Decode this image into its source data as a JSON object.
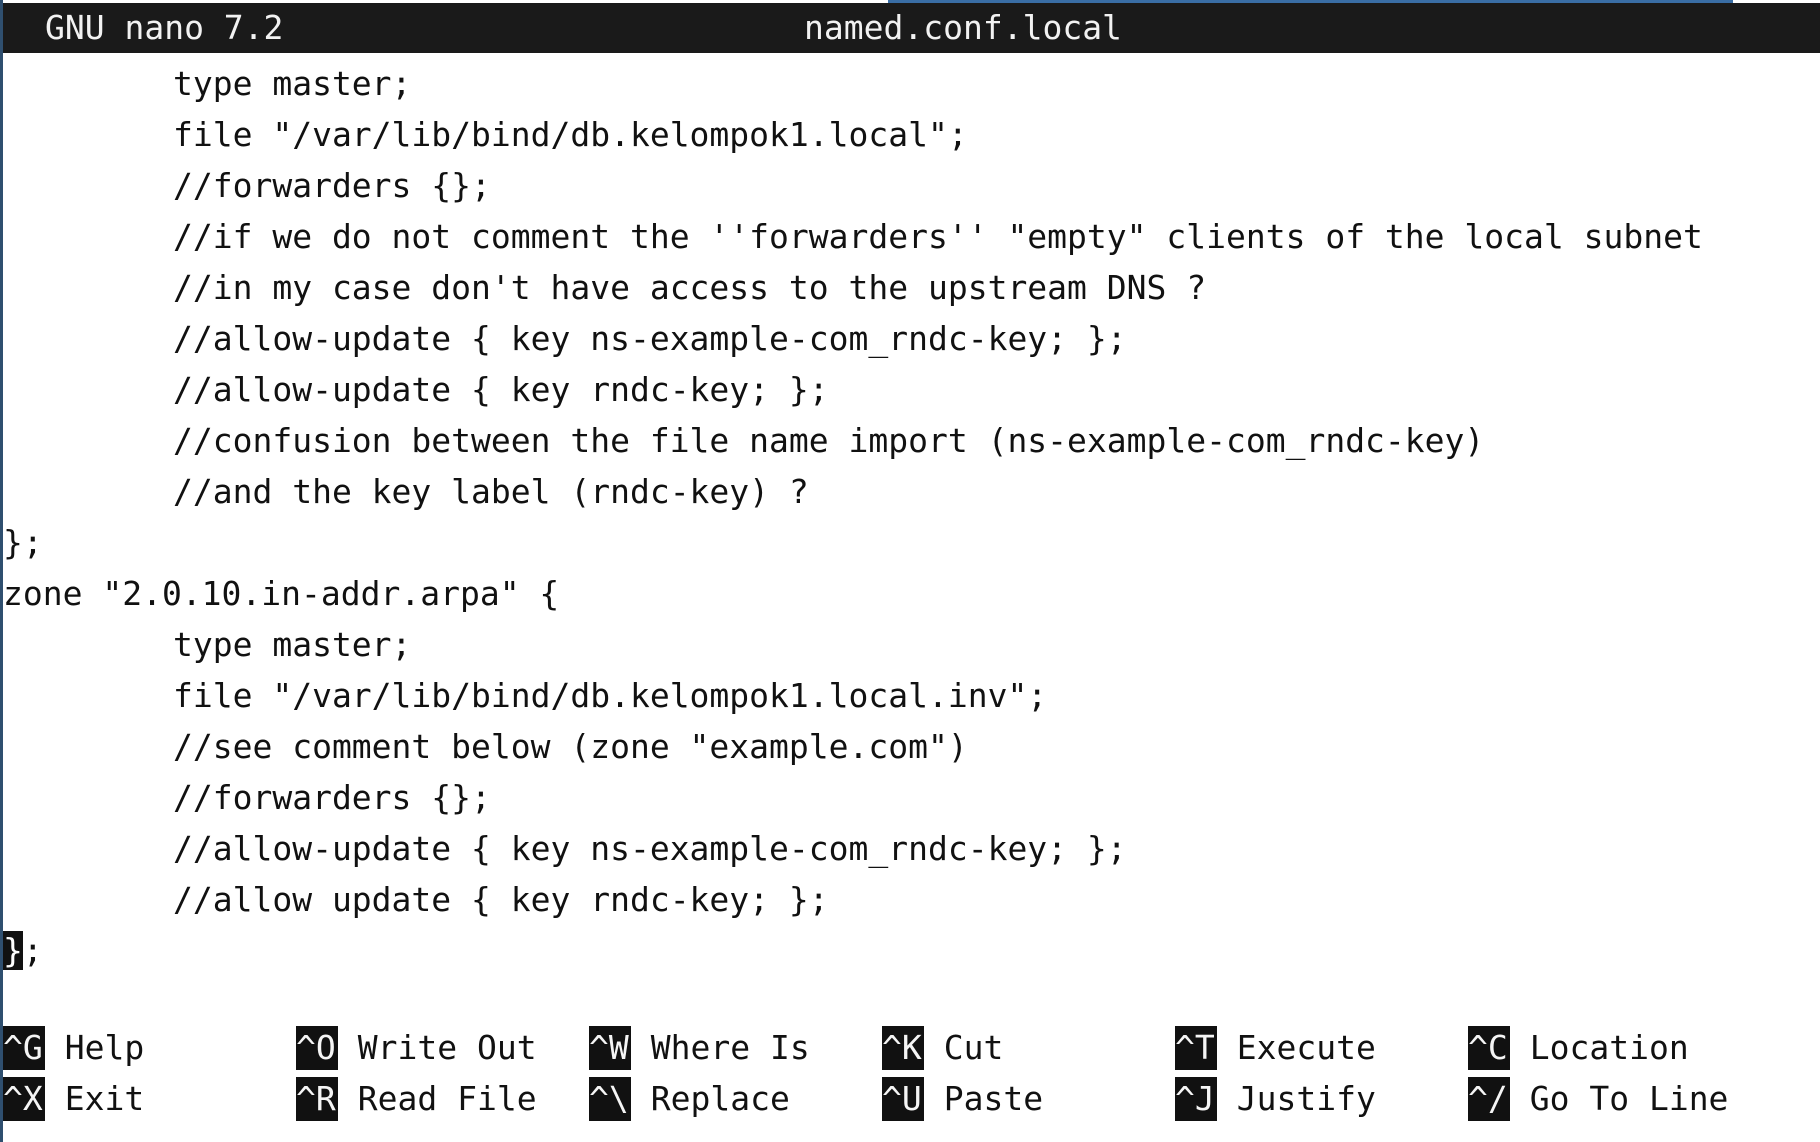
{
  "titlebar": {
    "app_version": "GNU nano 7.2",
    "filename": "named.conf.local"
  },
  "editor": {
    "lines": [
      {
        "indent": true,
        "text": "type master;"
      },
      {
        "indent": true,
        "text": "file \"/var/lib/bind/db.kelompok1.local\";"
      },
      {
        "indent": true,
        "text": "//forwarders {};"
      },
      {
        "indent": true,
        "text": "//if we do not comment the ''forwarders'' \"empty\" clients of the local subnet"
      },
      {
        "indent": true,
        "text": "//in my case don't have access to the upstream DNS ?"
      },
      {
        "indent": true,
        "text": "//allow-update { key ns-example-com_rndc-key; };"
      },
      {
        "indent": true,
        "text": "//allow-update { key rndc-key; };"
      },
      {
        "indent": true,
        "text": "//confusion between the file name import (ns-example-com_rndc-key)"
      },
      {
        "indent": true,
        "text": "//and the key label (rndc-key) ?"
      },
      {
        "indent": false,
        "text": "};"
      },
      {
        "indent": false,
        "text": "zone \"2.0.10.in-addr.arpa\" {"
      },
      {
        "indent": true,
        "text": "type master;"
      },
      {
        "indent": true,
        "text": "file \"/var/lib/bind/db.kelompok1.local.inv\";"
      },
      {
        "indent": true,
        "text": "//see comment below (zone \"example.com\")"
      },
      {
        "indent": true,
        "text": "//forwarders {};"
      },
      {
        "indent": true,
        "text": "//allow-update { key ns-example-com_rndc-key; };"
      },
      {
        "indent": true,
        "text": "//allow update { key rndc-key; };"
      }
    ],
    "cursor_line": {
      "cursor_char": "}",
      "rest": ";"
    }
  },
  "shortcuts": {
    "row1": [
      {
        "key": "^G",
        "label": "Help"
      },
      {
        "key": "^O",
        "label": "Write Out"
      },
      {
        "key": "^W",
        "label": "Where Is"
      },
      {
        "key": "^K",
        "label": "Cut"
      },
      {
        "key": "^T",
        "label": "Execute"
      },
      {
        "key": "^C",
        "label": "Location"
      }
    ],
    "row2": [
      {
        "key": "^X",
        "label": "Exit"
      },
      {
        "key": "^R",
        "label": "Read File"
      },
      {
        "key": "^\\",
        "label": "Replace"
      },
      {
        "key": "^U",
        "label": "Paste"
      },
      {
        "key": "^J",
        "label": "Justify"
      },
      {
        "key": "^/",
        "label": "Go To Line"
      }
    ]
  },
  "colors": {
    "titlebar_bg": "#1a1a1a",
    "titlebar_fg": "#f2f2f2",
    "editor_bg": "#ffffff",
    "text": "#111111"
  }
}
